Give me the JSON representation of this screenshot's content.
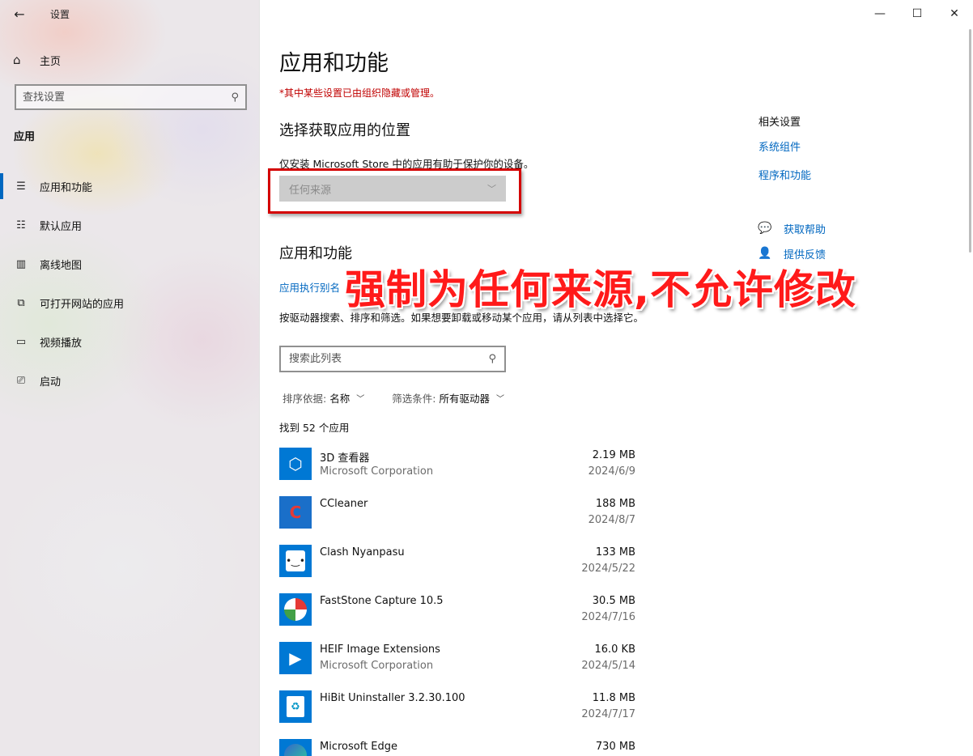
{
  "window": {
    "app_title": "设置",
    "controls": {
      "minimize": "—",
      "maximize": "☐",
      "close": "✕"
    }
  },
  "sidebar": {
    "home_label": "主页",
    "search_placeholder": "查找设置",
    "section_label": "应用",
    "items": [
      {
        "label": "应用和功能",
        "icon": "apps-features-icon",
        "active": true
      },
      {
        "label": "默认应用",
        "icon": "default-apps-icon",
        "active": false
      },
      {
        "label": "离线地图",
        "icon": "offline-maps-icon",
        "active": false
      },
      {
        "label": "可打开网站的应用",
        "icon": "apps-for-websites-icon",
        "active": false
      },
      {
        "label": "视频播放",
        "icon": "video-playback-icon",
        "active": false
      },
      {
        "label": "启动",
        "icon": "startup-icon",
        "active": false
      }
    ]
  },
  "main": {
    "title": "应用和功能",
    "managed_notice": "*其中某些设置已由组织隐藏或管理。",
    "location_heading": "选择获取应用的位置",
    "store_desc": "仅安装 Microsoft Store 中的应用有助于保护你的设备。",
    "source_value": "任何来源",
    "apps_heading": "应用和功能",
    "alias_link": "应用执行别名",
    "overlay_text": "强制为任何来源,不允许修改",
    "filter_desc": "按驱动器搜索、排序和筛选。如果想要卸载或移动某个应用，请从列表中选择它。",
    "list_search_placeholder": "搜索此列表",
    "sort_key": "排序依据:",
    "sort_value": "名称",
    "filter_key": "筛选条件:",
    "filter_value": "所有驱动器",
    "found_text": "找到 52 个应用",
    "apps": [
      {
        "name": "3D 查看器",
        "publisher": "Microsoft Corporation",
        "size": "2.19 MB",
        "date": "2024/6/9"
      },
      {
        "name": "CCleaner",
        "publisher": "",
        "size": "188 MB",
        "date": "2024/8/7"
      },
      {
        "name": "Clash Nyanpasu",
        "publisher": "",
        "size": "133 MB",
        "date": "2024/5/22"
      },
      {
        "name": "FastStone Capture 10.5",
        "publisher": "",
        "size": "30.5 MB",
        "date": "2024/7/16"
      },
      {
        "name": "HEIF Image Extensions",
        "publisher": "Microsoft Corporation",
        "size": "16.0 KB",
        "date": "2024/5/14"
      },
      {
        "name": "HiBit Uninstaller 3.2.30.100",
        "publisher": "",
        "size": "11.8 MB",
        "date": "2024/7/17"
      },
      {
        "name": "Microsoft Edge",
        "publisher": "",
        "size": "730 MB",
        "date": ""
      }
    ]
  },
  "related": {
    "title": "相关设置",
    "links": [
      "系统组件",
      "程序和功能"
    ],
    "help": [
      {
        "label": "获取帮助",
        "icon": "get-help-icon"
      },
      {
        "label": "提供反馈",
        "icon": "feedback-icon"
      }
    ]
  },
  "colors": {
    "accent": "#0067c0",
    "warning": "#c00000",
    "overlay": "#ff1a1a",
    "highlight_box": "#d40000"
  }
}
